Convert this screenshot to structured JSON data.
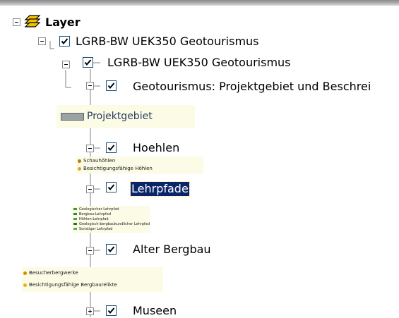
{
  "tree": {
    "root": {
      "label": "Layer"
    },
    "service": {
      "label": "LGRB-BW UEK350 Geotourismus"
    },
    "group": {
      "label": "LGRB-BW UEK350 Geotourismus"
    },
    "projekt": {
      "label": "Geotourismus: Projektgebiet und Beschrei",
      "legend": [
        "Projektgebiet"
      ]
    },
    "hoehlen": {
      "label": "Hoehlen",
      "legend": [
        "Schauhöhlen",
        "Besichtigungsfähige Höhlen"
      ]
    },
    "lehrpfade": {
      "label": "Lehrpfade",
      "legend": [
        "Geologischer Lehrpfad",
        "Bergbau-Lehrpfad",
        "Höhlen-Lehrpfad",
        "Geologisch-bergbaukundlicher Lehrpfad",
        "Sonstiger Lehrpfad"
      ]
    },
    "bergbau": {
      "label": "Alter Bergbau",
      "legend": [
        "Besucherbergwerke",
        "Besichtigungsfähige Bergbaurelikte"
      ]
    },
    "museen": {
      "label": "Museen"
    }
  },
  "colors": {
    "selection": "#0a246a",
    "legend_bg": "#fbfbe6",
    "check": "#21a121",
    "folder_icon": "#f2c400"
  }
}
